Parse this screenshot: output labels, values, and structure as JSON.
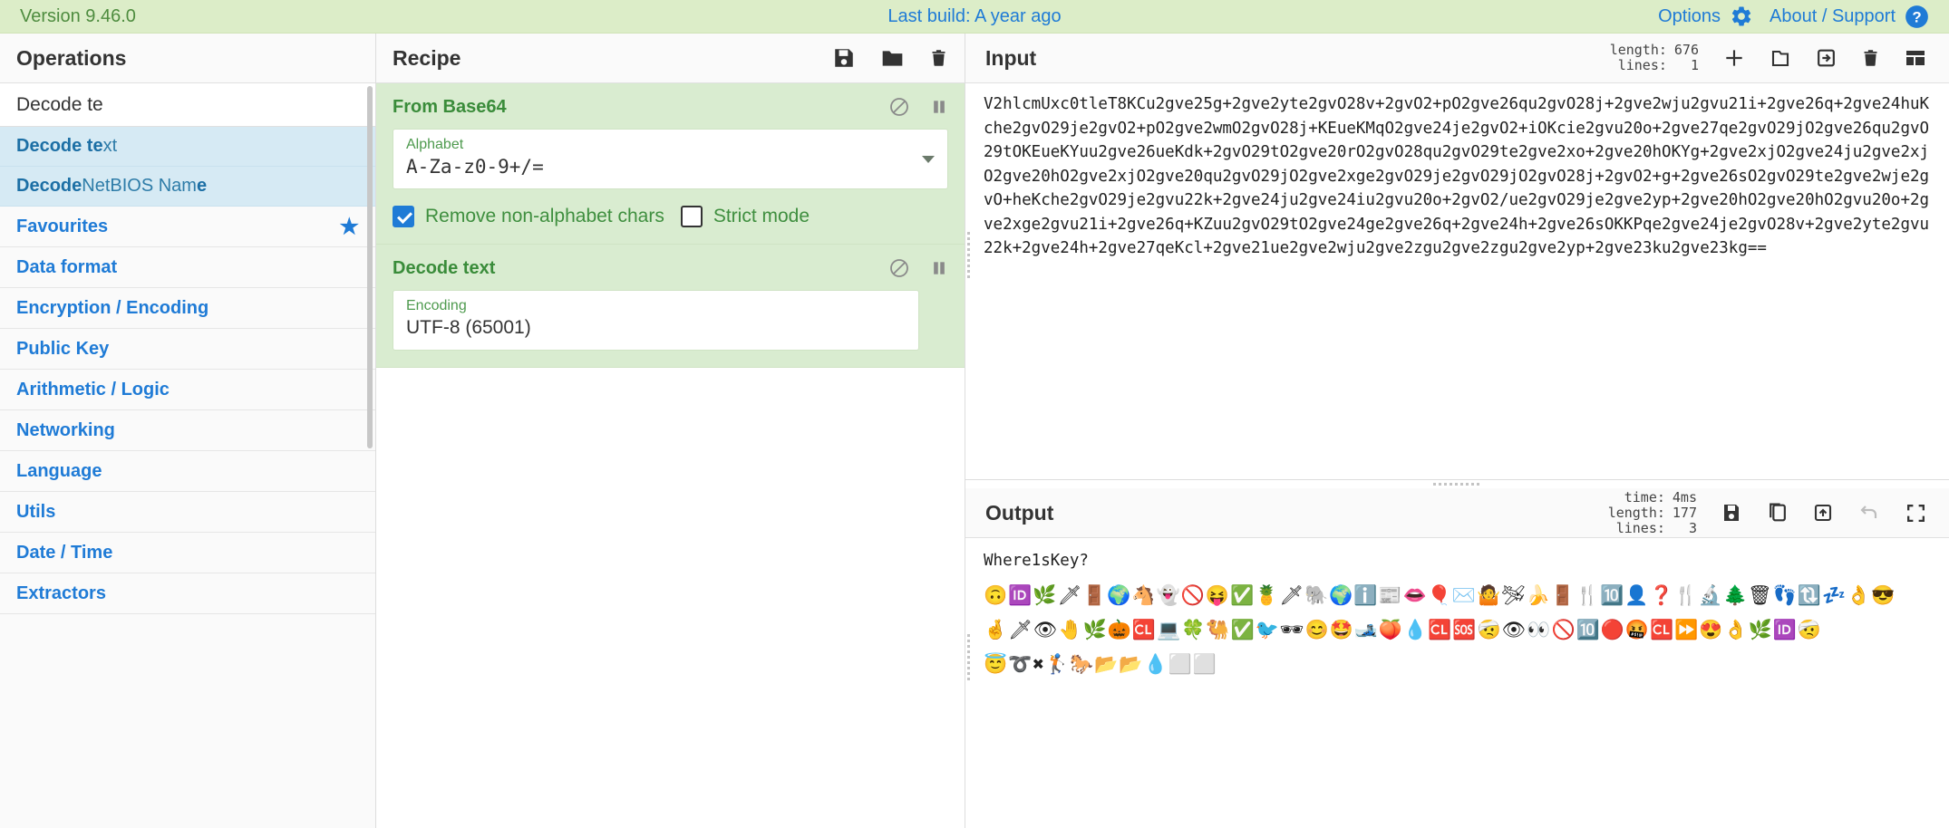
{
  "banner": {
    "version": "Version 9.46.0",
    "last_build": "Last build: A year ago",
    "options_label": "Options",
    "about_label": "About / Support",
    "gear_icon": "gear-icon",
    "help_icon": "question-circle-icon",
    "bg_color": "#dcedc8",
    "link_color": "#1f7bd6"
  },
  "operations": {
    "title": "Operations",
    "search": {
      "value": "Decode te",
      "placeholder": "Search..."
    },
    "results": [
      {
        "bold": "Decode te",
        "rest": "xt"
      },
      {
        "bold": "Decode ",
        "rest": "NetBIOS Nam",
        "bold2": "e"
      }
    ],
    "categories": [
      {
        "label": "Favourites",
        "star": true
      },
      {
        "label": "Data format",
        "star": false
      },
      {
        "label": "Encryption / Encoding",
        "star": false
      },
      {
        "label": "Public Key",
        "star": false
      },
      {
        "label": "Arithmetic / Logic",
        "star": false
      },
      {
        "label": "Networking",
        "star": false
      },
      {
        "label": "Language",
        "star": false
      },
      {
        "label": "Utils",
        "star": false
      },
      {
        "label": "Date / Time",
        "star": false
      },
      {
        "label": "Extractors",
        "star": false
      }
    ]
  },
  "recipe": {
    "title": "Recipe",
    "header_icons": [
      "save-icon",
      "folder-icon",
      "trash-icon"
    ],
    "operations": [
      {
        "name": "From Base64",
        "icons": [
          "disable-icon",
          "pause-icon"
        ],
        "args": [
          {
            "label": "Alphabet",
            "value": "A-Za-z0-9+/=",
            "type": "select",
            "mono": true
          }
        ],
        "checkboxes": [
          {
            "label": "Remove non-alphabet chars",
            "checked": true
          },
          {
            "label": "Strict mode",
            "checked": false
          }
        ]
      },
      {
        "name": "Decode text",
        "icons": [
          "disable-icon",
          "pause-icon"
        ],
        "args": [
          {
            "label": "Encoding",
            "value": "UTF-8 (65001)",
            "type": "select",
            "mono": false
          }
        ],
        "checkboxes": []
      }
    ]
  },
  "input": {
    "title": "Input",
    "meta": [
      {
        "key": "length:",
        "value": "676"
      },
      {
        "key": "lines:",
        "value": "1"
      }
    ],
    "icons": [
      "add-tab-icon",
      "open-folder-icon",
      "open-file-as-input-icon",
      "clear-io-icon",
      "reset-layout-icon"
    ],
    "value": "V2hlcmUxc0tleT8KCu2gve25g+2gve2yte2gvO28v+2gvO2+pO2gve26qu2gvO28j+2gve2wju2gvu21i+2gve26q+2gve24huKche2gvO29je2gvO2+pO2gve2wmO2gvO28j+KEueKMqO2gve24je2gvO2+iOKcie2gvu20o+2gve27qe2gvO29jO2gve26qu2gvO29tOKEueKYuu2gve26ueKdk+2gvO29tO2gve20rO2gvO28qu2gvO29te2gve2xo+2gve20hOKYg+2gve2xjO2gve24ju2gve2xjO2gve20hO2gve2xjO2gve20qu2gvO29jO2gve2xge2gvO29je2gvO29jO2gvO28j+2gvO2+g+2gve26sO2gvO29te2gve2wje2gvO+heKche2gvO29je2gvu22k+2gve24ju2gve24iu2gvu20o+2gvO2/ue2gvO29je2gve2yp+2gve20hO2gve20hO2gvu20o+2gve2xge2gvu21i+2gve26q+KZuu2gvO29tO2gve24ge2gve26q+2gve24h+2gve26sOKKPqe2gve24je2gvO28v+2gve2yte2gvu22k+2gve24h+2gve27qeKcl+2gve21ue2gve2wju2gve2zgu2gve2zgu2gve2yp+2gve23ku2gve23kg==",
    "wrapped_lines": [
      "V2hlcmUxc0tleT8KCu2gve25g+2gve2yte2gvO28v+2gvO2+pO2gve26qu2gvO28j+2gve2wju2gvu21i+2gve26q+2g",
      "ve24huKche2gvO29je2gvO2+pO2gve2wmO2gvO28j+KEueKMqO2gve24je2gvO2+iOKcie2gvu20o+2gve27qe2gvO29",
      "jO2gve26qu2gvO29tOKEueKYuu2gve26ueKdk+2gvO29tO2gve20rO2gvO28qu2gvO29te2gve2xo+2gve20hOKYg+2g",
      "ve2xjO2gve24ju2gve2xjO2gve20hO2gve2xjO2gve20qu2gvO29jO2gve2xge2gvO29je2gvO29jO2gvO28j+2gvO2+",
      "g+2gve26sO2gvO29te2gve2wje2gvO2+heKche2gvO29je2gvu22k+2gve24ju2gve24iu2gvu20o+2gvO2/ue2gvO29",
      "je2gve2yp+2gve20hO2gve20hO2gvu20o+2gve2xge2gvu21i+2gve26q+KZuu2gvO29tO2gve24ge2gve26q+2gve24",
      "h+2gve26sOKKPqe2gve24je2gvO28v+2gve2yte2gvu22k+2gve24h+2gve27qeKcl+2gve21ue2gve2wju2gve2zgu2g",
      "ve2zgu2gve2yp+2gve23ku2gve23kg=="
    ]
  },
  "output": {
    "title": "Output",
    "meta": [
      {
        "key": "time:",
        "value": "4ms"
      },
      {
        "key": "length:",
        "value": "177"
      },
      {
        "key": "lines:",
        "value": "3"
      }
    ],
    "icons": [
      "save-output-icon",
      "copy-output-icon",
      "replace-input-icon",
      "undo-icon",
      "maximise-icon"
    ],
    "line1": "Where1sKey?",
    "emoji_lines": [
      "🙃🆔🌿🗡🚪🌍🐴👻🚫😝✅🍍🗡🐘🌍ℹ️📰👄🎈✉️🤷🛩🍌🚪🍴🔟👤❓🍴🔬🌲🗑👣🔃💤👌😎",
      "🤞🗡👁🤚🌿🎃🆑💻🍀🐫✅🐦🕶😊🤩🎿🍑💧🆑🆘🤕👁👀🚫🔟🔴🤬🆑⏩😍👌🌿🆔🤕",
      "😇➰✖🏌🐎📂📂💧⬜⬜"
    ]
  }
}
